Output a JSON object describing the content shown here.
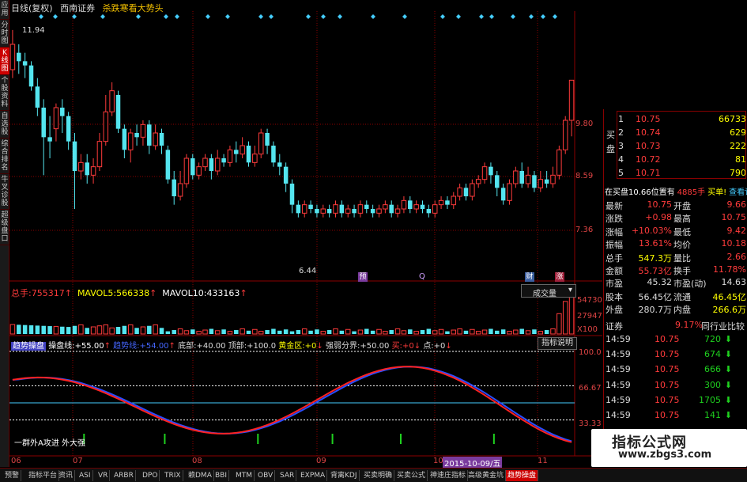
{
  "top": {
    "period": "日线(复权)",
    "broker": "西南证券",
    "signal": "杀跌寒看大势头"
  },
  "left_toolbar": [
    "应用",
    "分时图",
    "K线图",
    "个股资料",
    "自选股",
    "综合排名",
    "牛叉诊股",
    "超级盘口"
  ],
  "price_axis": [
    "9.80",
    "8.59",
    "7.36"
  ],
  "price_high_label": "11.94",
  "price_low_label": "6.44",
  "markers": [
    "预",
    "Q",
    "财",
    "涨"
  ],
  "volume_info": {
    "total_label": "总手:",
    "total_value": "755317",
    "mavol5_label": "MAVOL5:",
    "mavol5_value": "566338",
    "mavol10_label": "MAVOL10:",
    "mavol10_value": "433163"
  },
  "volume_dropdown": "成交量",
  "volume_axis": [
    "54730",
    "27947",
    "X100"
  ],
  "indicator_info": {
    "name": "趋势操盘",
    "line_label": "操盘线:",
    "line_value": "+55.00",
    "trend_label": "趋势线:",
    "trend_value": "+54.00",
    "bottom_label": "底部:",
    "bottom_value": "+40.00",
    "top_label": "顶部:",
    "top_value": "+100.0",
    "gold_label": "黄金区:",
    "gold_value": "+0",
    "boundary_label": "强弱分界:",
    "boundary_value": "+50.00",
    "buy_label": "买:",
    "buy_value": "+0",
    "point_label": "点:",
    "point_value": "+0"
  },
  "indicator_button": "指标说明",
  "indicator_axis": [
    "100.0",
    "66.67",
    "33.33"
  ],
  "indicator_bottom_text": "一群外A攻进 外大强",
  "x_axis": [
    "06",
    "07",
    "08",
    "09",
    "10",
    "11"
  ],
  "date_highlight": "2015-10-09/五",
  "order_book": [
    {
      "level": "1",
      "price": "10.75",
      "vol": "66733"
    },
    {
      "level": "2",
      "price": "10.74",
      "vol": "629"
    },
    {
      "level": "3",
      "price": "10.73",
      "vol": "222"
    },
    {
      "level": "4",
      "price": "10.72",
      "vol": "81"
    },
    {
      "level": "5",
      "price": "10.71",
      "vol": "790"
    }
  ],
  "buy_side_label": "买盘",
  "order_status": {
    "text": "在买盘10.66位置有",
    "vol": "4885手",
    "action": "买单!",
    "link": "查看详细"
  },
  "quote": [
    {
      "l1": "最新",
      "v1": "10.75",
      "l2": "开盘",
      "v2": "9.66"
    },
    {
      "l1": "涨跌",
      "v1": "+0.98",
      "l2": "最高",
      "v2": "10.75"
    },
    {
      "l1": "涨幅",
      "v1": "+10.03%",
      "l2": "最低",
      "v2": "9.42"
    },
    {
      "l1": "振幅",
      "v1": "13.61%",
      "l2": "均价",
      "v2": "10.18"
    },
    {
      "l1": "总手",
      "v1": "547.3万",
      "l2": "量比",
      "v2": "2.66"
    },
    {
      "l1": "金额",
      "v1": "55.73亿",
      "l2": "换手",
      "v2": "11.78%"
    },
    {
      "l1": "市盈",
      "v1": "45.32",
      "l2": "市盈(动)",
      "v2": "14.63"
    },
    {
      "l1": "股本",
      "v1": "56.45亿",
      "l2": "流通",
      "v2": "46.45亿"
    },
    {
      "l1": "外盘",
      "v1": "280.7万",
      "l2": "内盘",
      "v2": "266.6万"
    }
  ],
  "sector": {
    "label": "证券",
    "change": "9.17%",
    "link": "同行业比较"
  },
  "trades": [
    {
      "time": "14:59",
      "price": "10.75",
      "vol": "720",
      "dir": "down"
    },
    {
      "time": "14:59",
      "price": "10.75",
      "vol": "674",
      "dir": "down"
    },
    {
      "time": "14:59",
      "price": "10.75",
      "vol": "666",
      "dir": "down"
    },
    {
      "time": "14:59",
      "price": "10.75",
      "vol": "300",
      "dir": "down"
    },
    {
      "time": "14:59",
      "price": "10.75",
      "vol": "1705",
      "dir": "down"
    },
    {
      "time": "14:59",
      "price": "10.75",
      "vol": "141",
      "dir": "down"
    }
  ],
  "bottom_tabs": [
    "预警",
    "指标平台",
    "资讯",
    "ASI",
    "VR",
    "ARBR",
    "DPO",
    "TRIX",
    "赖DMA",
    "BBI",
    "MTM",
    "OBV",
    "SAR",
    "EXPMA",
    "背离KDJ",
    "买卖明确",
    "买卖公式",
    "神速庄指标",
    "高级黄金坑",
    "趋势操盘"
  ],
  "watermark": {
    "line1": "指标公式网",
    "line2": "www.zbgs3.com"
  },
  "colors": {
    "up": "#ff3b3b",
    "down": "#54e5ef",
    "grid": "#8b0000",
    "yellow": "#f3c000",
    "green": "#1fd11f"
  }
}
